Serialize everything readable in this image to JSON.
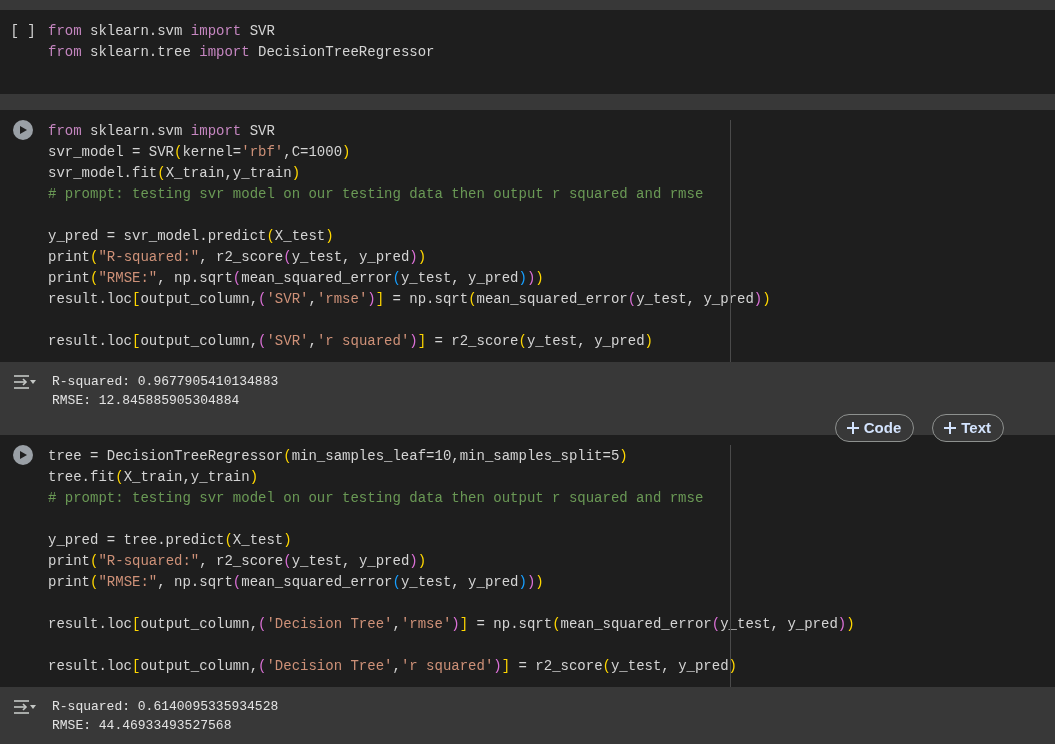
{
  "cells": [
    {
      "run_control": {
        "kind": "bracket",
        "text": "[ ]"
      },
      "ruler": false,
      "blocks": [
        [
          [
            {
              "kind": "kw",
              "text": "from"
            },
            {
              "kind": "p",
              "text": " sklearn.svm "
            },
            {
              "kind": "kw",
              "text": "import"
            },
            {
              "kind": "p",
              "text": " SVR"
            }
          ],
          [
            {
              "kind": "kw",
              "text": "from"
            },
            {
              "kind": "p",
              "text": " sklearn.tree "
            },
            {
              "kind": "kw",
              "text": "import"
            },
            {
              "kind": "p",
              "text": " DecisionTreeRegressor"
            }
          ]
        ]
      ]
    },
    {
      "run_control": {
        "kind": "play"
      },
      "ruler": true,
      "blocks": [
        [
          [
            {
              "kind": "kw",
              "text": "from"
            },
            {
              "kind": "p",
              "text": " sklearn.svm "
            },
            {
              "kind": "kw",
              "text": "import"
            },
            {
              "kind": "p",
              "text": " SVR"
            }
          ],
          [
            {
              "kind": "p",
              "text": "svr_model = SVR"
            },
            {
              "kind": "b1",
              "text": "("
            },
            {
              "kind": "p",
              "text": "kernel="
            },
            {
              "kind": "s",
              "text": "'rbf'"
            },
            {
              "kind": "p",
              "text": ",C=1000"
            },
            {
              "kind": "b1",
              "text": ")"
            }
          ],
          [
            {
              "kind": "p",
              "text": "svr_model.fit"
            },
            {
              "kind": "b1",
              "text": "("
            },
            {
              "kind": "p",
              "text": "X_train,y_train"
            },
            {
              "kind": "b1",
              "text": ")"
            }
          ],
          [
            {
              "kind": "c",
              "text": "# prompt: testing svr model on our testing data then output r squared and rmse"
            }
          ]
        ],
        [
          [
            {
              "kind": "p",
              "text": "y_pred = svr_model.predict"
            },
            {
              "kind": "b1",
              "text": "("
            },
            {
              "kind": "p",
              "text": "X_test"
            },
            {
              "kind": "b1",
              "text": ")"
            }
          ],
          [
            {
              "kind": "p",
              "text": "print"
            },
            {
              "kind": "b1",
              "text": "("
            },
            {
              "kind": "s",
              "text": "\"R-squared:\""
            },
            {
              "kind": "p",
              "text": ", r2_score"
            },
            {
              "kind": "b2",
              "text": "("
            },
            {
              "kind": "p",
              "text": "y_test, y_pred"
            },
            {
              "kind": "b2",
              "text": ")"
            },
            {
              "kind": "b1",
              "text": ")"
            }
          ],
          [
            {
              "kind": "p",
              "text": "print"
            },
            {
              "kind": "b1",
              "text": "("
            },
            {
              "kind": "s",
              "text": "\"RMSE:\""
            },
            {
              "kind": "p",
              "text": ", np.sqrt"
            },
            {
              "kind": "b2",
              "text": "("
            },
            {
              "kind": "p",
              "text": "mean_squared_error"
            },
            {
              "kind": "b3",
              "text": "("
            },
            {
              "kind": "p",
              "text": "y_test, y_pred"
            },
            {
              "kind": "b3",
              "text": ")"
            },
            {
              "kind": "b2",
              "text": ")"
            },
            {
              "kind": "b1",
              "text": ")"
            }
          ],
          [
            {
              "kind": "p",
              "text": "result.loc"
            },
            {
              "kind": "b1",
              "text": "["
            },
            {
              "kind": "p",
              "text": "output_column,"
            },
            {
              "kind": "b2",
              "text": "("
            },
            {
              "kind": "s",
              "text": "'SVR'"
            },
            {
              "kind": "p",
              "text": ","
            },
            {
              "kind": "s",
              "text": "'rmse'"
            },
            {
              "kind": "b2",
              "text": ")"
            },
            {
              "kind": "b1",
              "text": "]"
            },
            {
              "kind": "p",
              "text": " = np.sqrt"
            },
            {
              "kind": "b1",
              "text": "("
            },
            {
              "kind": "p",
              "text": "mean_squared_error"
            },
            {
              "kind": "b2",
              "text": "("
            },
            {
              "kind": "p",
              "text": "y_test, y_pred"
            },
            {
              "kind": "b2",
              "text": ")"
            },
            {
              "kind": "b1",
              "text": ")"
            }
          ]
        ],
        [
          [
            {
              "kind": "p",
              "text": "result.loc"
            },
            {
              "kind": "b1",
              "text": "["
            },
            {
              "kind": "p",
              "text": "output_column,"
            },
            {
              "kind": "b2",
              "text": "("
            },
            {
              "kind": "s",
              "text": "'SVR'"
            },
            {
              "kind": "p",
              "text": ","
            },
            {
              "kind": "s",
              "text": "'r squared'"
            },
            {
              "kind": "b2",
              "text": ")"
            },
            {
              "kind": "b1",
              "text": "]"
            },
            {
              "kind": "p",
              "text": " = r2_score"
            },
            {
              "kind": "b1",
              "text": "("
            },
            {
              "kind": "p",
              "text": "y_test, y_pred"
            },
            {
              "kind": "b1",
              "text": ")"
            }
          ]
        ]
      ],
      "output": [
        "R-squared: 0.9677905410134883",
        "RMSE: 12.845885905304884"
      ]
    },
    {
      "run_control": {
        "kind": "play"
      },
      "ruler": true,
      "blocks": [
        [
          [
            {
              "kind": "p",
              "text": "tree = DecisionTreeRegressor"
            },
            {
              "kind": "b1",
              "text": "("
            },
            {
              "kind": "p",
              "text": "min_samples_leaf=10,min_samples_split=5"
            },
            {
              "kind": "b1",
              "text": ")"
            }
          ],
          [
            {
              "kind": "p",
              "text": "tree.fit"
            },
            {
              "kind": "b1",
              "text": "("
            },
            {
              "kind": "p",
              "text": "X_train,y_train"
            },
            {
              "kind": "b1",
              "text": ")"
            }
          ],
          [
            {
              "kind": "c",
              "text": "# prompt: testing svr model on our testing data then output r squared and rmse"
            }
          ]
        ],
        [
          [
            {
              "kind": "p",
              "text": "y_pred = tree.predict"
            },
            {
              "kind": "b1",
              "text": "("
            },
            {
              "kind": "p",
              "text": "X_test"
            },
            {
              "kind": "b1",
              "text": ")"
            }
          ],
          [
            {
              "kind": "p",
              "text": "print"
            },
            {
              "kind": "b1",
              "text": "("
            },
            {
              "kind": "s",
              "text": "\"R-squared:\""
            },
            {
              "kind": "p",
              "text": ", r2_score"
            },
            {
              "kind": "b2",
              "text": "("
            },
            {
              "kind": "p",
              "text": "y_test, y_pred"
            },
            {
              "kind": "b2",
              "text": ")"
            },
            {
              "kind": "b1",
              "text": ")"
            }
          ],
          [
            {
              "kind": "p",
              "text": "print"
            },
            {
              "kind": "b1",
              "text": "("
            },
            {
              "kind": "s",
              "text": "\"RMSE:\""
            },
            {
              "kind": "p",
              "text": ", np.sqrt"
            },
            {
              "kind": "b2",
              "text": "("
            },
            {
              "kind": "p",
              "text": "mean_squared_error"
            },
            {
              "kind": "b3",
              "text": "("
            },
            {
              "kind": "p",
              "text": "y_test, y_pred"
            },
            {
              "kind": "b3",
              "text": ")"
            },
            {
              "kind": "b2",
              "text": ")"
            },
            {
              "kind": "b1",
              "text": ")"
            }
          ]
        ],
        [
          [
            {
              "kind": "p",
              "text": "result.loc"
            },
            {
              "kind": "b1",
              "text": "["
            },
            {
              "kind": "p",
              "text": "output_column,"
            },
            {
              "kind": "b2",
              "text": "("
            },
            {
              "kind": "s",
              "text": "'Decision Tree'"
            },
            {
              "kind": "p",
              "text": ","
            },
            {
              "kind": "s",
              "text": "'rmse'"
            },
            {
              "kind": "b2",
              "text": ")"
            },
            {
              "kind": "b1",
              "text": "]"
            },
            {
              "kind": "p",
              "text": " = np.sqrt"
            },
            {
              "kind": "b1",
              "text": "("
            },
            {
              "kind": "p",
              "text": "mean_squared_error"
            },
            {
              "kind": "b2",
              "text": "("
            },
            {
              "kind": "p",
              "text": "y_test, y_pred"
            },
            {
              "kind": "b2",
              "text": ")"
            },
            {
              "kind": "b1",
              "text": ")"
            }
          ]
        ],
        [
          [
            {
              "kind": "p",
              "text": "result.loc"
            },
            {
              "kind": "b1",
              "text": "["
            },
            {
              "kind": "p",
              "text": "output_column,"
            },
            {
              "kind": "b2",
              "text": "("
            },
            {
              "kind": "s",
              "text": "'Decision Tree'"
            },
            {
              "kind": "p",
              "text": ","
            },
            {
              "kind": "s",
              "text": "'r squared'"
            },
            {
              "kind": "b2",
              "text": ")"
            },
            {
              "kind": "b1",
              "text": "]"
            },
            {
              "kind": "p",
              "text": " = r2_score"
            },
            {
              "kind": "b1",
              "text": "("
            },
            {
              "kind": "p",
              "text": "y_test, y_pred"
            },
            {
              "kind": "b1",
              "text": ")"
            }
          ]
        ]
      ],
      "output": [
        "R-squared: 0.6140095335934528",
        "RMSE: 44.46933493527568"
      ]
    }
  ],
  "add_cell_buttons": [
    {
      "label": "Code"
    },
    {
      "label": "Text"
    }
  ]
}
